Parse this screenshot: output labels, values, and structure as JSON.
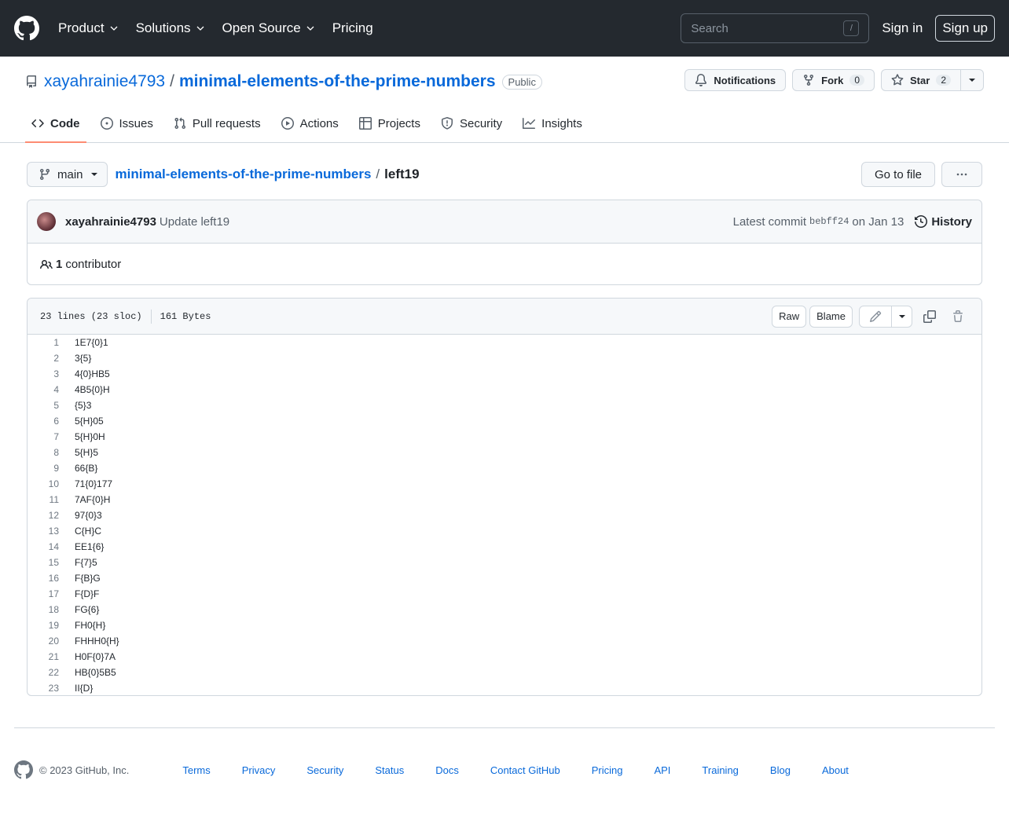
{
  "header": {
    "nav": [
      {
        "label": "Product",
        "has_menu": true
      },
      {
        "label": "Solutions",
        "has_menu": true
      },
      {
        "label": "Open Source",
        "has_menu": true
      },
      {
        "label": "Pricing",
        "has_menu": false
      }
    ],
    "search_placeholder": "Search",
    "search_shortcut": "/",
    "sign_in": "Sign in",
    "sign_up": "Sign up"
  },
  "repo": {
    "owner": "xayahrainie4793",
    "separator": "/",
    "name": "minimal-elements-of-the-prime-numbers",
    "visibility": "Public",
    "notifications_label": "Notifications",
    "fork_label": "Fork",
    "fork_count": "0",
    "star_label": "Star",
    "star_count": "2",
    "tabs": [
      {
        "label": "Code",
        "icon": "code-icon",
        "active": true
      },
      {
        "label": "Issues",
        "icon": "issue-icon",
        "active": false
      },
      {
        "label": "Pull requests",
        "icon": "pull-request-icon",
        "active": false
      },
      {
        "label": "Actions",
        "icon": "play-icon",
        "active": false
      },
      {
        "label": "Projects",
        "icon": "table-icon",
        "active": false
      },
      {
        "label": "Security",
        "icon": "shield-icon",
        "active": false
      },
      {
        "label": "Insights",
        "icon": "graph-icon",
        "active": false
      }
    ]
  },
  "breadcrumb": {
    "branch": "main",
    "repo_link": "minimal-elements-of-the-prime-numbers",
    "separator": "/",
    "file": "left19",
    "go_to_file": "Go to file"
  },
  "commit": {
    "author": "xayahrainie4793",
    "message": "Update left19",
    "latest_prefix": "Latest commit",
    "sha": "bebff24",
    "date": "on Jan 13",
    "history": "History",
    "contributors_count": "1",
    "contributors_label": "contributor"
  },
  "file": {
    "lines_info": "23 lines (23 sloc)",
    "size_info": "161 Bytes",
    "raw": "Raw",
    "blame": "Blame",
    "lines": [
      "1E7{0}1",
      "3{5}",
      "4{0}HB5",
      "4B5{0}H",
      "{5}3",
      "5{H}05",
      "5{H}0H",
      "5{H}5",
      "66{B}",
      "71{0}177",
      "7AF{0}H",
      "97{0}3",
      "C{H}C",
      "EE1{6}",
      "F{7}5",
      "F{B}G",
      "F{D}F",
      "FG{6}",
      "FH0{H}",
      "FHHH0{H}",
      "H0F{0}7A",
      "HB{0}5B5",
      "II{D}"
    ]
  },
  "footer": {
    "copyright": "© 2023 GitHub, Inc.",
    "links": [
      "Terms",
      "Privacy",
      "Security",
      "Status",
      "Docs",
      "Contact GitHub",
      "Pricing",
      "API",
      "Training",
      "Blog",
      "About"
    ]
  },
  "colors": {
    "header_bg": "#24292f",
    "link": "#0969da",
    "active_tab_underline": "#fd8c73",
    "border": "#d0d7de"
  }
}
